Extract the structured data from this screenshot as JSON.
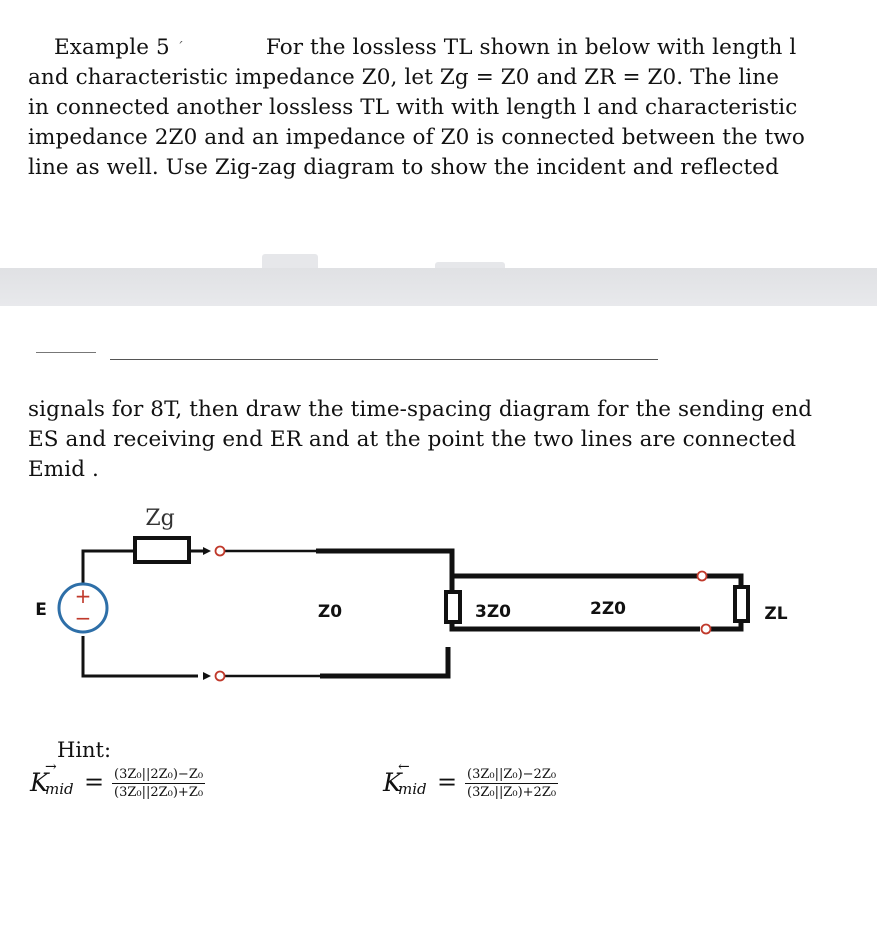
{
  "problem": {
    "label": "Example 5",
    "line1": "For the lossless TL shown in below with length l",
    "line2": "and characteristic impedance Z0, let Zg = Z0 and ZR = Z0.  The line",
    "line3": "in connected another lossless TL with with length l and characteristic",
    "line4": "impedance 2Z0 and an impedance of Z0 is connected between the two",
    "line5": "line as well.  Use Zig-zag diagram to show the incident and reflected",
    "line6": "signals for 8T, then draw the time-spacing diagram for the sending end",
    "line7": "ES and receiving end ER and at the point the two lines are connected",
    "line8": "Emid ."
  },
  "circuit": {
    "source_label": "E",
    "source_plus": "+",
    "source_minus": "−",
    "zg_label": "Zg",
    "line1_label": "Z0",
    "mid_load_label": "3Z0",
    "line2_label": "2Z0",
    "load_label": "ZL",
    "colors": {
      "wire": "#111111",
      "source": "#2e6fa8",
      "source_sign": "#c0392b",
      "terminal": "#c0392b"
    }
  },
  "hint": {
    "title": "Hint:",
    "k_forward": {
      "symbol": "K",
      "arrow": "→",
      "sub": "mid",
      "equals": "=",
      "numerator": "(3Z₀||2Z₀)−Z₀",
      "denominator": "(3Z₀||2Z₀)+Z₀"
    },
    "k_backward": {
      "symbol": "K",
      "arrow": "←",
      "sub": "mid",
      "equals": "=",
      "numerator": "(3Z₀||Z₀)−2Z₀",
      "denominator": "(3Z₀||Z₀)+2Z₀"
    }
  }
}
